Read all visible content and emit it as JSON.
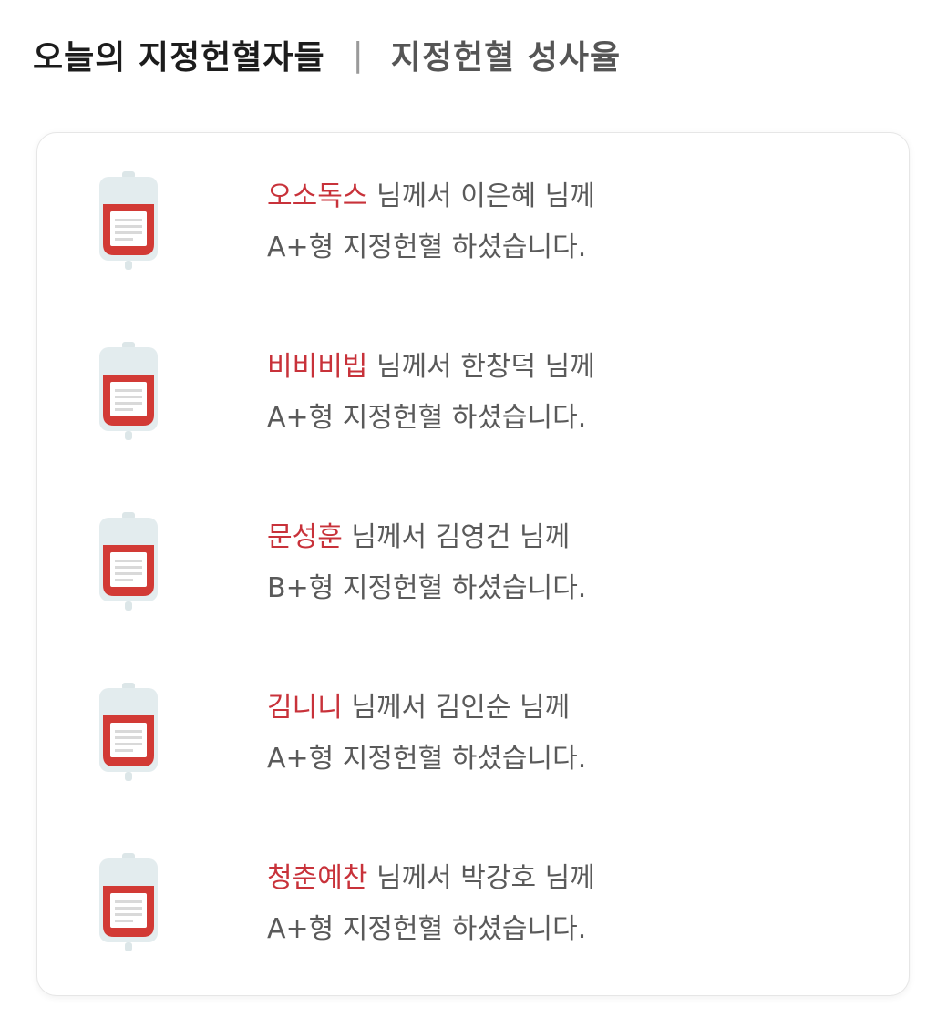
{
  "tabs": {
    "active_label": "오늘의 지정헌혈자들",
    "divider": "|",
    "inactive_label": "지정헌혈 성사율"
  },
  "entries": [
    {
      "donor": "오소독스",
      "middle": " 님께서 ",
      "recipient": "이은혜  님께",
      "result": "A+형 지정헌혈 하셨습니다."
    },
    {
      "donor": "비비비빕",
      "middle": " 님께서 ",
      "recipient": "한창덕 님께",
      "result": "A+형 지정헌혈 하셨습니다."
    },
    {
      "donor": "문성훈",
      "middle": " 님께서 ",
      "recipient": "김영건  님께",
      "result": "B+형 지정헌혈 하셨습니다."
    },
    {
      "donor": "김니니",
      "middle": " 님께서 ",
      "recipient": "김인순 님께",
      "result": "A+형 지정헌혈 하셨습니다."
    },
    {
      "donor": "청춘예찬",
      "middle": " 님께서 ",
      "recipient": "박강호 님께",
      "result": "A+형 지정헌혈 하셨습니다."
    }
  ],
  "colors": {
    "accent": "#c8323a",
    "text": "#5a5a5a",
    "bag_body": "#e3ecee",
    "blood": "#d23a35"
  }
}
